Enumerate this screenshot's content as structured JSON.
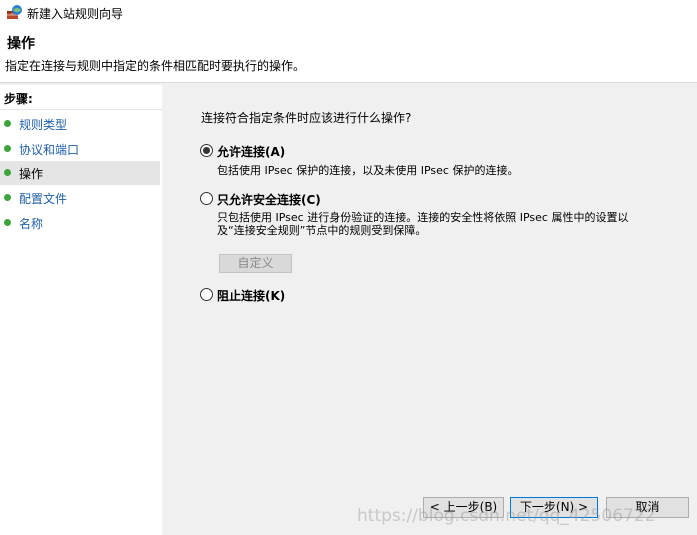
{
  "window": {
    "title": "新建入站规则向导",
    "icon": "firewall-wizard-icon"
  },
  "header": {
    "title": "操作",
    "subtitle": "指定在连接与规则中指定的条件相匹配时要执行的操作。"
  },
  "sidebar": {
    "steps_label": "步骤:",
    "steps": [
      {
        "label": "规则类型",
        "active": false
      },
      {
        "label": "协议和端口",
        "active": false
      },
      {
        "label": "操作",
        "active": true
      },
      {
        "label": "配置文件",
        "active": false
      },
      {
        "label": "名称",
        "active": false
      }
    ],
    "dot_color": "#3ca43c"
  },
  "main": {
    "question": "连接符合指定条件时应该进行什么操作?",
    "options": [
      {
        "label": "允许连接(A)",
        "selected": true,
        "description": "包括使用 IPsec 保护的连接，以及未使用 IPsec 保护的连接。"
      },
      {
        "label": "只允许安全连接(C)",
        "selected": false,
        "description": "只包括使用 IPsec 进行身份验证的连接。连接的安全性将依照 IPsec 属性中的设置以及“连接安全规则”节点中的规则受到保障。"
      },
      {
        "label": "阻止连接(K)",
        "selected": false,
        "description": ""
      }
    ],
    "customize_label": "自定义"
  },
  "footer": {
    "back_label": "< 上一步(B)",
    "next_label": "下一步(N) >",
    "cancel_label": "取消"
  },
  "watermark": "https://blog.csdn.net/qq_42506722"
}
